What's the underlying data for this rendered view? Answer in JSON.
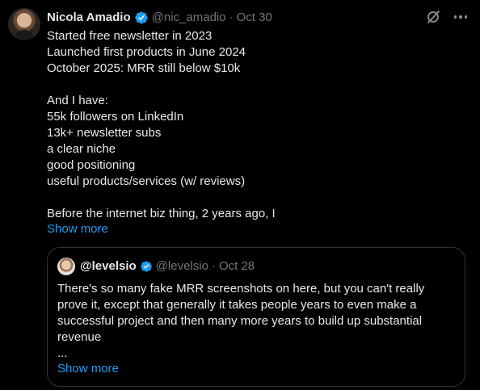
{
  "tweet": {
    "author_name": "Nicola Amadio",
    "author_handle": "@nic_amadio",
    "separator": "·",
    "date": "Oct 30",
    "lines": [
      "Started free newsletter in 2023",
      "Launched first products in June 2024",
      "October 2025: MRR still below $10k",
      "",
      "And I have:",
      "55k followers on LinkedIn",
      "13k+ newsletter subs",
      "a clear niche",
      "good positioning",
      "useful products/services (w/ reviews)",
      "",
      "Before the internet biz thing, 2 years ago, I"
    ],
    "show_more": "Show more"
  },
  "quote": {
    "author_name": "@levelsio",
    "author_handle": "@levelsio",
    "separator": "·",
    "date": "Oct 28",
    "lines": [
      "There's so many fake MRR screenshots on here, but you can't really",
      "prove it, except that generally it takes people years to even make a",
      "successful project and then many more years to build up substantial",
      "revenue",
      "..."
    ],
    "show_more": "Show more"
  },
  "icons": {
    "verified": "verified-badge-icon",
    "grok": "grok-icon",
    "more": "more-options-icon"
  },
  "colors": {
    "background": "#000000",
    "text": "#e7e9ea",
    "muted": "#71767b",
    "link": "#1d9bf0",
    "border": "#2f3336"
  }
}
